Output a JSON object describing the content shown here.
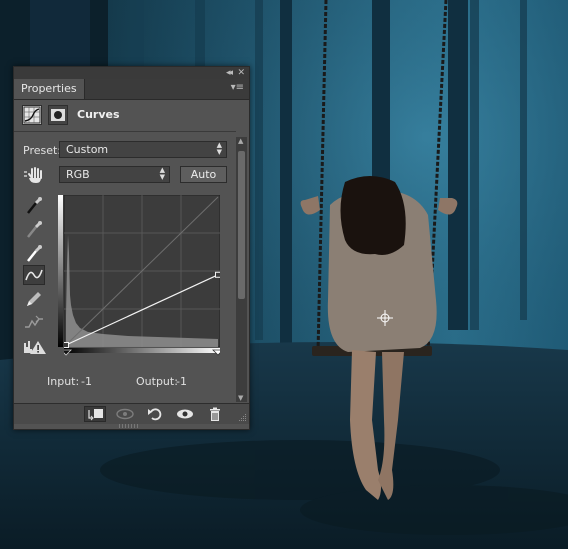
{
  "panel": {
    "tab_label": "Properties",
    "collapse_glyph": "◂◂",
    "close_glyph": "✕",
    "menu_glyph": "▾≡",
    "adjustment_title": "Curves",
    "preset_label": "Preset:",
    "preset_value": "Custom",
    "channel_value": "RGB",
    "auto_label": "Auto",
    "input_label": "Input:",
    "input_value": "-1",
    "output_label": "Output:",
    "output_value": "-1"
  },
  "icons": {
    "header": [
      "curves-adjustment-icon",
      "mask-icon"
    ],
    "tools": [
      "targeted-adjustment-hand-icon",
      "black-point-eyedropper-icon",
      "gray-point-eyedropper-icon",
      "white-point-eyedropper-icon",
      "curve-point-edit-icon",
      "pencil-icon",
      "smooth-curve-icon",
      "clipping-warning-icon"
    ],
    "bottom": [
      "clip-to-layer-icon",
      "view-previous-state-icon",
      "reset-icon",
      "visibility-eye-icon",
      "trash-icon"
    ]
  },
  "curve": {
    "points_0_255": [
      [
        0,
        0
      ],
      [
        255,
        121
      ]
    ],
    "histogram_shape": "dark-heavy"
  },
  "colors": {
    "panel_bg": "#535353",
    "panel_dark": "#3a3a3a",
    "graph_bg": "#3c3c3c",
    "scene_blue": "#1f4f66"
  }
}
